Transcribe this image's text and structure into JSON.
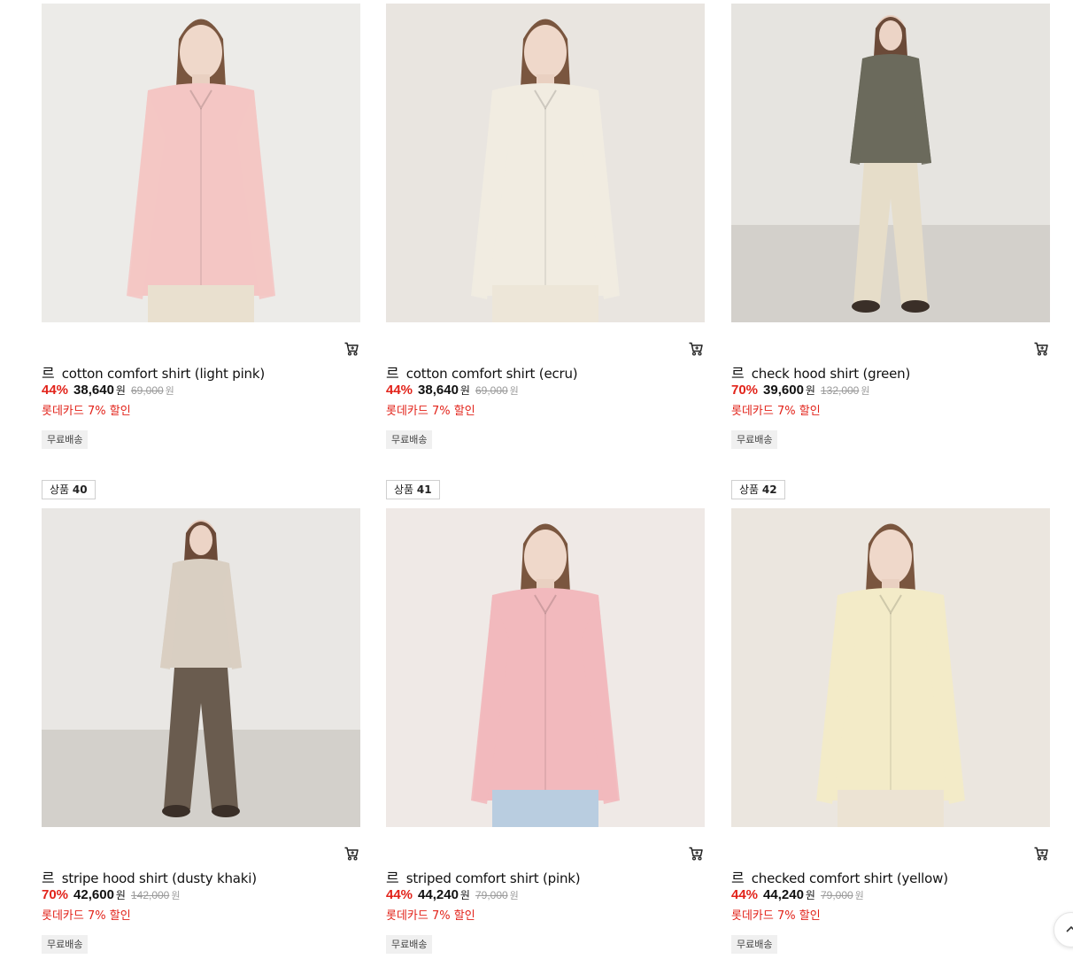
{
  "products": [
    {
      "brand": "르",
      "name": "cotton comfort shirt (light pink)",
      "discount": "44%",
      "price": "38,640",
      "won": "원",
      "original_price": "69,000",
      "card_promo": "롯데카드 7% 할인",
      "shipping": "무료배송",
      "shirt_color": "#f4c6c4",
      "bg_color": "#ecebe8",
      "pants_color": "#e9e0cf"
    },
    {
      "brand": "르",
      "name": "cotton comfort shirt (ecru)",
      "discount": "44%",
      "price": "38,640",
      "won": "원",
      "original_price": "69,000",
      "card_promo": "롯데카드 7% 할인",
      "shipping": "무료배송",
      "shirt_color": "#f1ece1",
      "bg_color": "#e9e5e0",
      "pants_color": "#ede6d8"
    },
    {
      "brand": "르",
      "name": "check hood shirt (green)",
      "discount": "70%",
      "price": "39,600",
      "won": "원",
      "original_price": "132,000",
      "card_promo": "롯데카드 7% 할인",
      "shipping": "무료배송",
      "shirt_color": "#6b6a5c",
      "bg_color": "#e6e4e0",
      "pants_color": "#e6ddc9"
    },
    {
      "rank_label": "상품",
      "rank_number": "40",
      "brand": "르",
      "name": "stripe hood shirt (dusty khaki)",
      "discount": "70%",
      "price": "42,600",
      "won": "원",
      "original_price": "142,000",
      "card_promo": "롯데카드 7% 할인",
      "shipping": "무료배송",
      "shirt_color": "#d9cfc2",
      "bg_color": "#e9e7e4",
      "pants_color": "#6a5c4f"
    },
    {
      "rank_label": "상품",
      "rank_number": "41",
      "brand": "르",
      "name": "striped comfort shirt (pink)",
      "discount": "44%",
      "price": "44,240",
      "won": "원",
      "original_price": "79,000",
      "card_promo": "롯데카드 7% 할인",
      "shipping": "무료배송",
      "shirt_color": "#f2b9bd",
      "bg_color": "#efe9e6",
      "pants_color": "#b9cde0"
    },
    {
      "rank_label": "상품",
      "rank_number": "42",
      "brand": "르",
      "name": "checked comfort shirt (yellow)",
      "discount": "44%",
      "price": "44,240",
      "won": "원",
      "original_price": "79,000",
      "card_promo": "롯데카드 7% 할인",
      "shipping": "무료배송",
      "shirt_color": "#f3ebc8",
      "bg_color": "#ebe6df",
      "pants_color": "#ece3d3"
    }
  ],
  "icons": {
    "cart": "cart-icon",
    "scroll_top": "chevron-up-icon"
  },
  "colors": {
    "discount_red": "#e2231a",
    "tag_bg": "#f0f0f0"
  }
}
